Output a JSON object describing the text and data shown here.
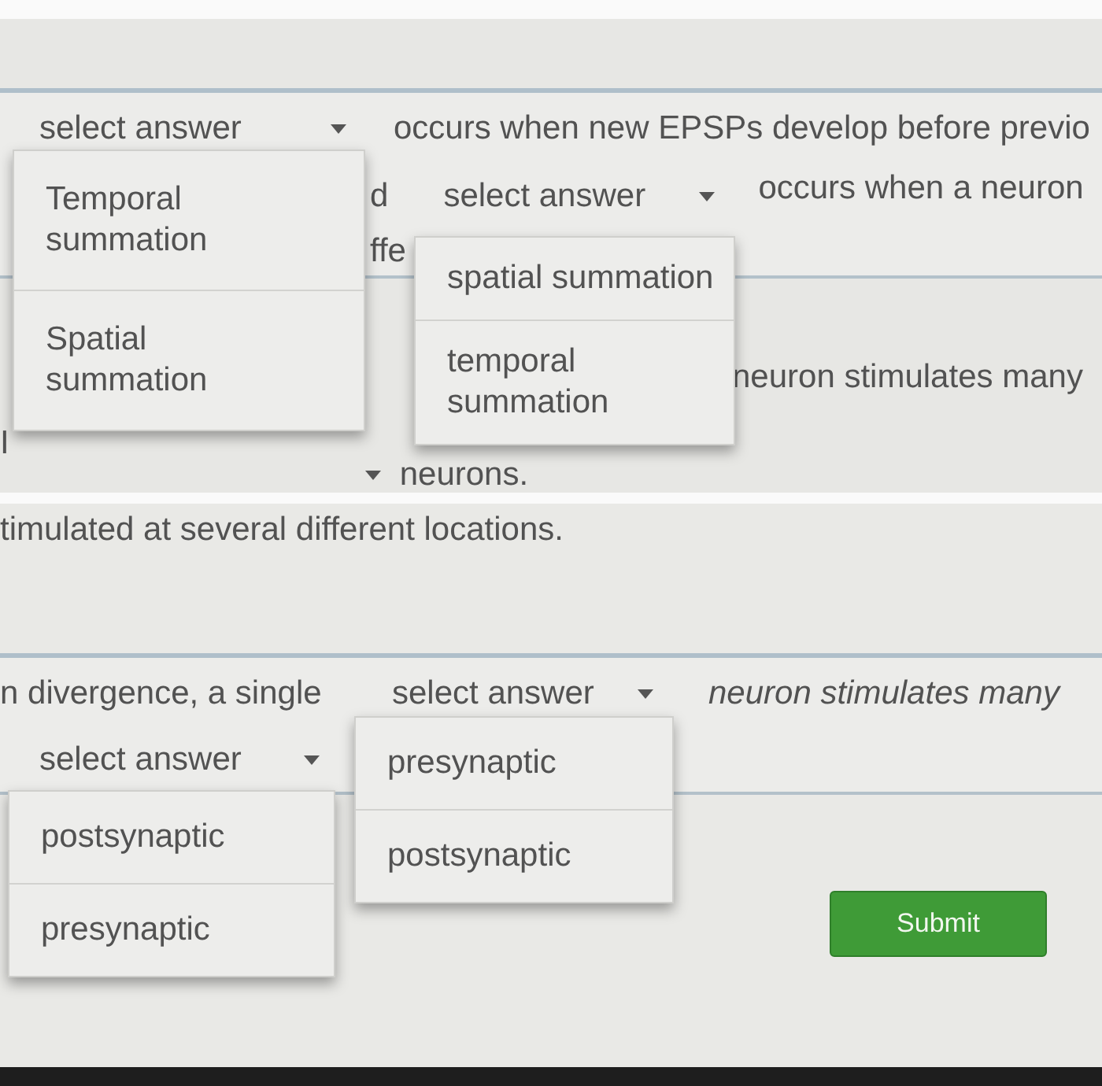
{
  "upper_screen": {
    "question_1": {
      "dropdown": {
        "placeholder": "select answer",
        "expanded": true,
        "options": [
          {
            "label": "Temporal summation",
            "selected": false
          },
          {
            "label": "Spatial summation",
            "selected": false
          }
        ]
      },
      "text_after": "occurs when new EPSPs develop before previo"
    },
    "fragment_1": "d",
    "question_2": {
      "dropdown": {
        "placeholder": "select answer",
        "expanded": true,
        "options": [
          {
            "label": "spatial summation",
            "selected": false
          },
          {
            "label": "temporal summation",
            "selected": false
          }
        ]
      },
      "text_after": "occurs when a neuron"
    },
    "fragment_2": "ffe",
    "line_1": "neuron stimulates many",
    "fragment_3": "I",
    "line_2": "neurons."
  },
  "lower_screen": {
    "line_1": "timulated at several different locations.",
    "question": {
      "text_before": "n divergence, a single",
      "dropdown": {
        "placeholder": "select answer",
        "expanded": true,
        "options": [
          {
            "label": "presynaptic",
            "selected": false
          },
          {
            "label": "postsynaptic",
            "selected": false
          }
        ]
      },
      "text_after": "neuron stimulates many"
    },
    "dropdown_2": {
      "placeholder": "select answer",
      "expanded": true,
      "options": [
        {
          "label": "postsynaptic",
          "selected": false
        },
        {
          "label": "presynaptic",
          "selected": false
        }
      ]
    },
    "submit_button": {
      "label": "Submit"
    }
  }
}
